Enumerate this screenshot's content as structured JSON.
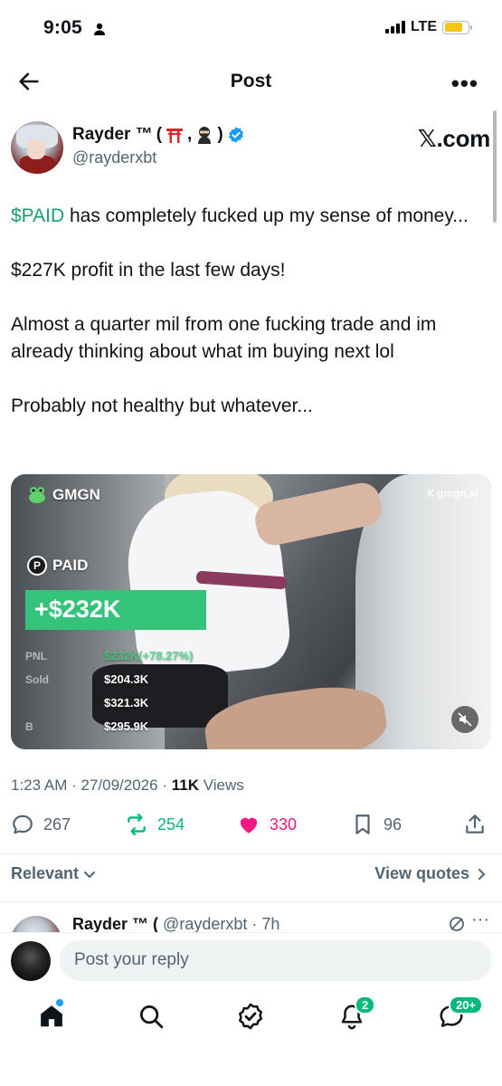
{
  "status": {
    "time": "9:05",
    "network": "LTE"
  },
  "nav": {
    "title": "Post"
  },
  "author": {
    "name": "Rayder ™",
    "name_suffix_open": "(",
    "name_suffix_sep": ",",
    "name_suffix_close": ")",
    "handle": "@rayderxbt",
    "source": "𝕏.com"
  },
  "tweet": {
    "cashtag": "$PAID",
    "line1_rest": " has completely fucked up my sense of money...",
    "paragraph2": "$227K profit in the last few days!",
    "paragraph3": "Almost a quarter mil from one fucking trade and im already thinking about what im buying next lol",
    "paragraph4": "Probably not healthy but whatever..."
  },
  "media": {
    "brand": "GMGN",
    "watermark": "X gmgn.ai",
    "token": "PAID",
    "pnl": "+$232K",
    "stat_labels": [
      "PNL",
      "Sold",
      "",
      "B"
    ],
    "stat_values": [
      "$232K(+78.27%)",
      "$204.3K",
      "$321.3K",
      "$295.9K"
    ]
  },
  "meta": {
    "time": "1:23 AM",
    "date": "27/09/2026",
    "views_count": "11K",
    "views_label": "Views"
  },
  "actions": {
    "replies": "267",
    "reposts": "254",
    "likes": "330",
    "bookmarks": "96"
  },
  "replies_header": {
    "sort": "Relevant",
    "view_quotes": "View quotes"
  },
  "reply_preview": {
    "name": "Rayder ™ (",
    "handle": "@rayderxbt · 7h"
  },
  "reply_bar": {
    "placeholder": "Post your reply"
  },
  "tabbar": {
    "notifications_badge": "2",
    "messages_badge": "20+"
  },
  "colors": {
    "accent_green": "#00ba7c",
    "like_pink": "#f91880",
    "text_secondary": "#536471",
    "pnl_green": "#35c37a"
  }
}
